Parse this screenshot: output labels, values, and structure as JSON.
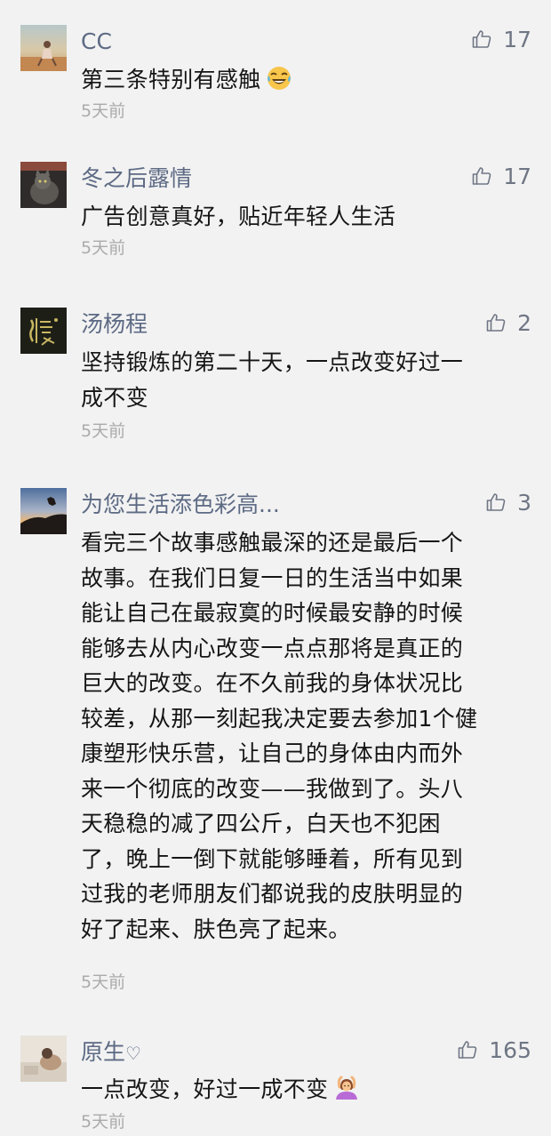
{
  "comments": [
    {
      "name": "CC",
      "likes": "17",
      "lines": [
        "第三条特别有感触"
      ],
      "emoji": "laughing-crying-emoji",
      "time": "5天前"
    },
    {
      "name": "冬之后露情",
      "likes": "17",
      "lines": [
        "广告创意真好，贴近年轻人生活"
      ],
      "time": "5天前"
    },
    {
      "name": "汤杨程",
      "likes": "2",
      "lines": [
        "坚持锻炼的第二十天，一点改变好过一",
        "成不变"
      ],
      "time": "5天前"
    },
    {
      "name": "为您生活添色彩高...",
      "likes": "3",
      "lines": [
        "看完三个故事感触最深的还是最后一个",
        "故事。在我们日复一日的生活当中如果",
        "能让自己在最寂寞的时候最安静的时候",
        "能够去从内心改变一点点那将是真正的",
        "巨大的改变。在不久前我的身体状况比",
        "较差，从那一刻起我决定要去参加1个健",
        "康塑形快乐营，让自己的身体由内而外",
        "来一个彻底的改变——我做到了。头八",
        "天稳稳的减了四公斤，白天也不犯困",
        "了，晚上一倒下就能够睡着，所有见到",
        "过我的老师朋友们都说我的皮肤明显的",
        "好了起来、肤色亮了起来。"
      ],
      "time": "5天前"
    },
    {
      "name": "原生",
      "name_suffix": "♡",
      "likes": "165",
      "lines": [
        "一点改变，好过一成不变"
      ],
      "emoji": "person-gesturing-ok-emoji",
      "time": "5天前"
    }
  ],
  "colors": {
    "background": "#f2f2f2",
    "name": "#5d6a84",
    "text": "#151515",
    "time": "#ababab",
    "like": "#6f7684"
  },
  "icons": {
    "like": "thumbs-up-icon"
  }
}
